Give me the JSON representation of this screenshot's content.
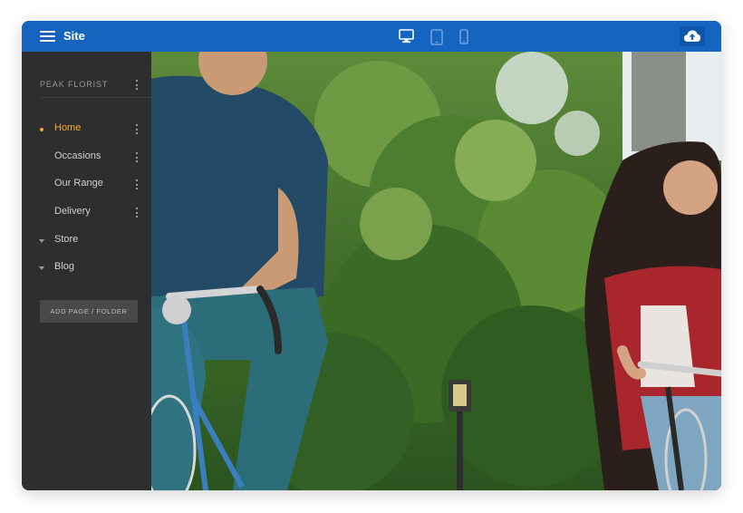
{
  "topbar": {
    "site_label": "Site",
    "menu_icon": "hamburger-menu-icon",
    "device_icons": [
      "desktop-icon",
      "tablet-icon",
      "mobile-icon"
    ],
    "publish_icon": "cloud-upload-icon"
  },
  "sidebar": {
    "brand": "PEAK FLORIST",
    "items": [
      {
        "label": "Home",
        "active": true,
        "marker": "bullet"
      },
      {
        "label": "Occasions",
        "active": false,
        "marker": "none"
      },
      {
        "label": "Our Range",
        "active": false,
        "marker": "none"
      },
      {
        "label": "Delivery",
        "active": false,
        "marker": "none"
      },
      {
        "label": "Store",
        "active": false,
        "marker": "caret"
      },
      {
        "label": "Blog",
        "active": false,
        "marker": "caret"
      }
    ],
    "add_button": "ADD PAGE / FOLDER"
  },
  "colors": {
    "topbar": "#1565c0",
    "sidebar": "#2e2e30",
    "active_accent": "#f7a934"
  },
  "hero": {
    "image_description_icon": "photo-two-cyclists"
  }
}
